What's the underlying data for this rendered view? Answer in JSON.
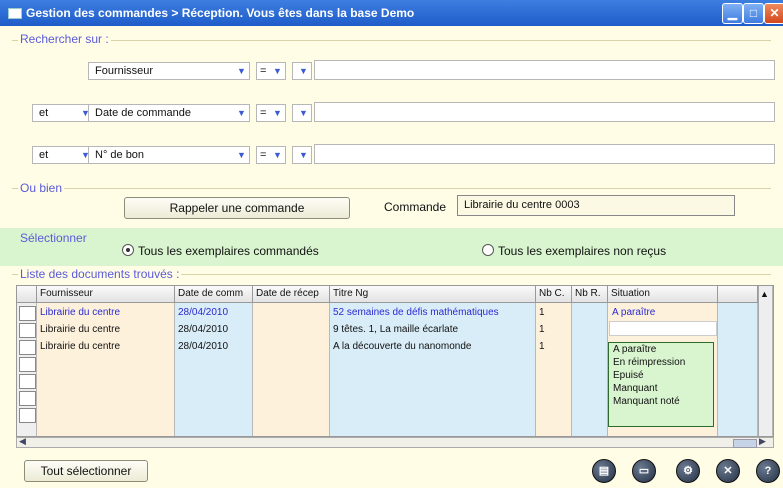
{
  "window": {
    "title": "Gestion des commandes > Réception.  Vous êtes dans la base Demo",
    "min_glyph": "▁",
    "max_glyph": "□",
    "close_glyph": "✕"
  },
  "search": {
    "legend": "Rechercher sur :",
    "rows": [
      {
        "logic": "",
        "field": "Fournisseur",
        "operator": "=",
        "value": ""
      },
      {
        "logic": "et",
        "field": "Date de commande",
        "operator": "=",
        "value": ""
      },
      {
        "logic": "et",
        "field": "N° de bon",
        "operator": "=",
        "value": ""
      }
    ],
    "dropdown_glyph": "▼"
  },
  "or_section": {
    "legend": "Ou bien",
    "recall_button": "Rappeler une commande",
    "order_label": "Commande",
    "order_value": "Librairie du centre 0003"
  },
  "select_section": {
    "legend": "Sélectionner",
    "option_all": "Tous les exemplaires commandés",
    "option_not_received": "Tous les exemplaires non reçus",
    "selected": "all"
  },
  "results": {
    "legend": "Liste des documents trouvés :",
    "columns": [
      "Fournisseur",
      "Date de comm",
      "Date de récep",
      "Titre Ng",
      "Nb C.",
      "Nb R.",
      "Situation"
    ],
    "rows": [
      {
        "fournisseur": "Librairie du centre",
        "date_commande": "28/04/2010",
        "date_reception": "",
        "titre": "52 semaines de défis mathématiques",
        "nb_c": "1",
        "nb_r": "",
        "situation": "A paraître"
      },
      {
        "fournisseur": "Librairie du centre",
        "date_commande": "28/04/2010",
        "date_reception": "",
        "titre": "9 têtes. 1, La maille écarlate",
        "nb_c": "1",
        "nb_r": "",
        "situation": ""
      },
      {
        "fournisseur": "Librairie du centre",
        "date_commande": "28/04/2010",
        "date_reception": "",
        "titre": "A la découverte du nanomonde",
        "nb_c": "1",
        "nb_r": "",
        "situation": ""
      }
    ],
    "situation_options": [
      "A paraître",
      "En réimpression",
      "Epuisé",
      "Manquant",
      "Manquant noté"
    ]
  },
  "footer": {
    "select_all_button": "Tout sélectionner",
    "icons": [
      "print-icon",
      "save-icon",
      "settings-icon",
      "delete-icon",
      "help-icon"
    ],
    "icon_glyphs": [
      "▤",
      "▭",
      "⚙",
      "✕",
      "?"
    ]
  },
  "colors": {
    "title_bar": "#2a68d6",
    "background": "#fffde6",
    "green_band": "#d9f5cf",
    "selected_row_text": "#2a2ad0"
  }
}
